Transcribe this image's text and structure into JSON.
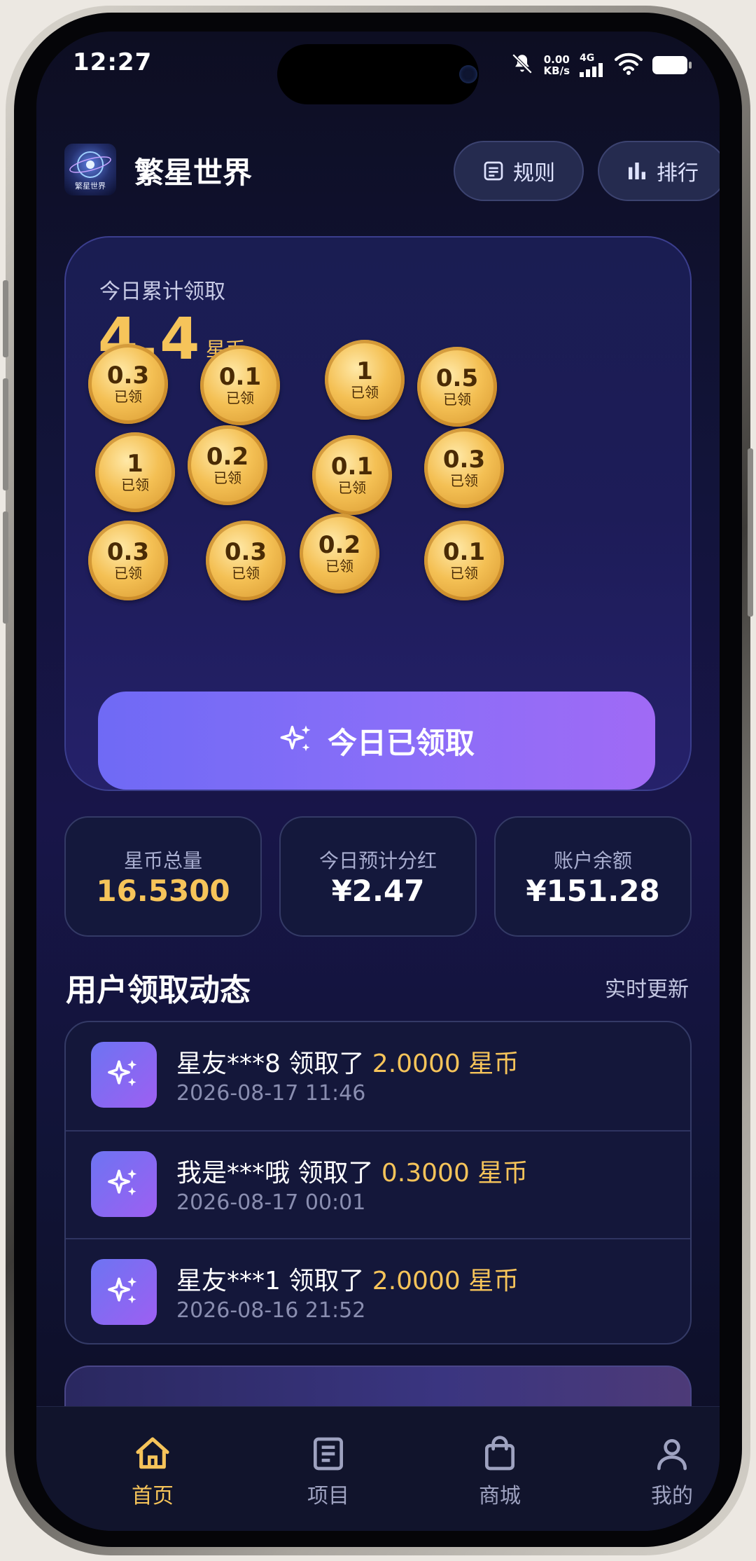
{
  "status_bar": {
    "time": "12:27",
    "net_speed_value": "0.00",
    "net_speed_unit": "KB/s",
    "network": "4G"
  },
  "header": {
    "logo_text": "繁星世界",
    "title": "繁星世界",
    "rules_label": "规则",
    "rank_label": "排行"
  },
  "claim_card": {
    "label": "今日累计领取",
    "value": "4.4",
    "unit": "星币",
    "coins": [
      {
        "value": "0.3",
        "status": "已领"
      },
      {
        "value": "0.1",
        "status": "已领"
      },
      {
        "value": "1",
        "status": "已领"
      },
      {
        "value": "0.5",
        "status": "已领"
      },
      {
        "value": "1",
        "status": "已领"
      },
      {
        "value": "0.2",
        "status": "已领"
      },
      {
        "value": "0.1",
        "status": "已领"
      },
      {
        "value": "0.3",
        "status": "已领"
      },
      {
        "value": "0.3",
        "status": "已领"
      },
      {
        "value": "0.3",
        "status": "已领"
      },
      {
        "value": "0.2",
        "status": "已领"
      },
      {
        "value": "0.1",
        "status": "已领"
      }
    ],
    "button_label": "今日已领取"
  },
  "stats": [
    {
      "label": "星币总量",
      "value": "16.5300"
    },
    {
      "label": "今日预计分红",
      "value": "¥2.47"
    },
    {
      "label": "账户余额",
      "value": "¥151.28"
    }
  ],
  "activity": {
    "title": "用户领取动态",
    "hint": "实时更新",
    "items": [
      {
        "text": "星友***8 领取了 ",
        "amount": "2.0000 星币",
        "time": "2026-08-17 11:46"
      },
      {
        "text": "我是***哦 领取了 ",
        "amount": "0.3000 星币",
        "time": "2026-08-17 00:01"
      },
      {
        "text": "星友***1 领取了 ",
        "amount": "2.0000 星币",
        "time": "2026-08-16 21:52"
      }
    ]
  },
  "tabbar": {
    "items": [
      {
        "label": "首页"
      },
      {
        "label": "项目"
      },
      {
        "label": "商城"
      },
      {
        "label": "我的"
      }
    ],
    "active_color": "#f6c45a",
    "inactive_color": "#9ea2c0"
  },
  "colors": {
    "accent_gold": "#f6c45a",
    "button_gradient_start": "#6f6af5",
    "button_gradient_end": "#a06af5",
    "background": "#12143a"
  }
}
